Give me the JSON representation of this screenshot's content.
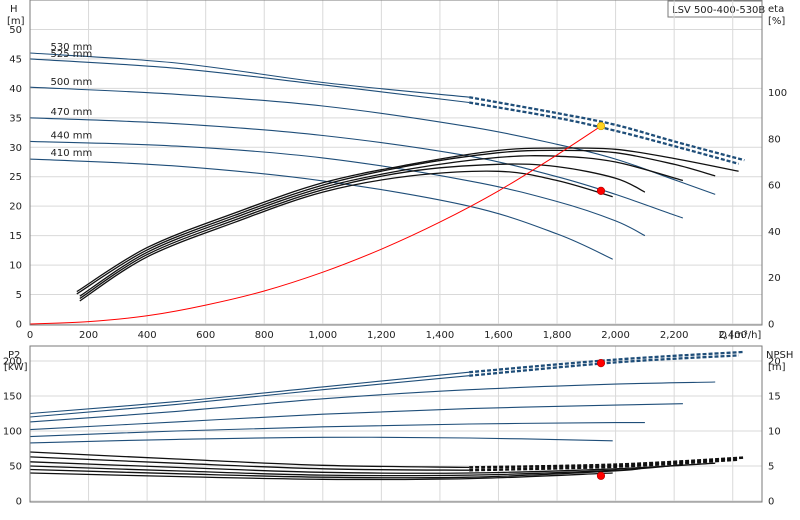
{
  "chart_data": [
    {
      "type": "line",
      "panel": "head",
      "title": "LSV 500-400-530B",
      "xlabel": "Q [m³/h]",
      "ylabel_left": {
        "name": "H",
        "unit": "[m]"
      },
      "ylabel_right": {
        "name": "eta",
        "unit": "[%]"
      },
      "xlim": [
        0,
        2500
      ],
      "ylim": [
        0,
        55
      ],
      "ylim_right": [
        0,
        140
      ],
      "x_ticks": [
        "0",
        "200",
        "400",
        "600",
        "800",
        "1,000",
        "1,200",
        "1,400",
        "1,600",
        "1,800",
        "2,000",
        "2,200",
        "2,400"
      ],
      "y_ticks": [
        "0",
        "5",
        "10",
        "15",
        "20",
        "25",
        "30",
        "35",
        "40",
        "45",
        "50"
      ],
      "y_right_ticks": [
        "0",
        "20",
        "40",
        "60",
        "80",
        "100"
      ],
      "grid": true,
      "colors": {
        "head": "#1f4e79",
        "efficiency": "#111111",
        "system": "#ff0000",
        "op_red": "#ff0000",
        "op_yellow": "#ffd21f"
      },
      "head_curves": [
        {
          "label": "530 mm",
          "x": [
            0,
            500,
            1000,
            1500,
            1800,
            2000,
            2200,
            2440
          ],
          "y": [
            46,
            44.3,
            41,
            38.5,
            35.8,
            33.8,
            31,
            27.8
          ],
          "dashed_from": 1500
        },
        {
          "label": "525 mm",
          "x": [
            0,
            500,
            1000,
            1500,
            1800,
            2000,
            2200,
            2420
          ],
          "y": [
            45,
            43.4,
            40.6,
            37.6,
            35,
            32.8,
            30.2,
            27.2
          ],
          "dashed_from": 1500
        },
        {
          "label": "500 mm",
          "x": [
            0,
            500,
            1000,
            1500,
            1800,
            2000,
            2200,
            2340
          ],
          "y": [
            40.2,
            39,
            37,
            33.5,
            30.5,
            28,
            24.5,
            22
          ]
        },
        {
          "label": "470 mm",
          "x": [
            0,
            500,
            1000,
            1500,
            1800,
            2000,
            2200,
            2230
          ],
          "y": [
            35,
            34,
            32,
            28.5,
            25,
            22,
            18.5,
            18
          ]
        },
        {
          "label": "440 mm",
          "x": [
            0,
            500,
            1000,
            1500,
            1800,
            2000,
            2100
          ],
          "y": [
            31,
            30.2,
            28.2,
            24.3,
            20.8,
            17.5,
            15
          ]
        },
        {
          "label": "410 mm",
          "x": [
            0,
            500,
            1000,
            1500,
            1800,
            1990
          ],
          "y": [
            28,
            26.8,
            24.3,
            20,
            15.3,
            11
          ]
        }
      ],
      "efficiency_curves": [
        {
          "x": [
            160,
            400,
            700,
            1000,
            1300,
            1600,
            1800,
            2000,
            2200,
            2420
          ],
          "y": [
            14,
            33,
            48,
            61,
            69,
            75,
            76,
            75.5,
            71.5,
            66
          ]
        },
        {
          "x": [
            160,
            400,
            700,
            1000,
            1300,
            1600,
            1800,
            2000,
            2200,
            2340
          ],
          "y": [
            13,
            32,
            47,
            60,
            68.5,
            74,
            75,
            74,
            69,
            64
          ]
        },
        {
          "x": [
            170,
            400,
            700,
            1000,
            1300,
            1600,
            1800,
            2000,
            2230
          ],
          "y": [
            12,
            31,
            46,
            59,
            67,
            72,
            72.5,
            70,
            62
          ]
        },
        {
          "x": [
            170,
            400,
            700,
            1000,
            1300,
            1600,
            1800,
            2000,
            2100
          ],
          "y": [
            11,
            30,
            45,
            58,
            66,
            69,
            68,
            63,
            57
          ]
        },
        {
          "x": [
            170,
            400,
            700,
            1000,
            1300,
            1600,
            1800,
            1990
          ],
          "y": [
            10,
            29,
            44,
            57,
            64,
            66,
            62,
            55
          ]
        }
      ],
      "system_curve": {
        "x": [
          0,
          200,
          400,
          600,
          800,
          1000,
          1200,
          1400,
          1600,
          1800,
          1950
        ],
        "y": [
          0,
          0.4,
          1.4,
          3.2,
          5.6,
          8.8,
          12.7,
          17.3,
          22.6,
          28.7,
          33.6
        ]
      },
      "operating_points": [
        {
          "x": 1950,
          "y": 33.6,
          "color": "yellow"
        },
        {
          "x": 1950,
          "y": 22.6,
          "color": "red"
        }
      ]
    },
    {
      "type": "line",
      "panel": "power_npsh",
      "ylabel_left": {
        "name": "P2",
        "unit": "[kW]"
      },
      "ylabel_right": {
        "name": "NPSH",
        "unit": "[m]"
      },
      "xlim": [
        0,
        2500
      ],
      "ylim": [
        0,
        220
      ],
      "ylim_right": [
        0,
        22
      ],
      "y_ticks": [
        "0",
        "50",
        "100",
        "150",
        "200"
      ],
      "y_right_ticks": [
        "0",
        "5",
        "10",
        "15",
        "20"
      ],
      "grid": true,
      "power_curves": [
        {
          "label": "530 mm",
          "x": [
            0,
            500,
            1000,
            1500,
            2000,
            2440
          ],
          "y": [
            125,
            142,
            163,
            184,
            202,
            213
          ],
          "dashed_from": 1500
        },
        {
          "label": "525 mm",
          "x": [
            0,
            500,
            1000,
            1500,
            2000,
            2420
          ],
          "y": [
            120,
            138,
            159,
            179,
            198,
            208
          ],
          "dashed_from": 1500
        },
        {
          "label": "500 mm",
          "x": [
            0,
            500,
            1000,
            1500,
            2000,
            2340
          ],
          "y": [
            113,
            128,
            146,
            159,
            167,
            170
          ]
        },
        {
          "label": "470 mm",
          "x": [
            0,
            500,
            1000,
            1500,
            2000,
            2230
          ],
          "y": [
            102,
            113,
            124,
            132,
            137,
            139
          ]
        },
        {
          "label": "440 mm",
          "x": [
            0,
            500,
            1000,
            1500,
            2000,
            2100
          ],
          "y": [
            92,
            100,
            106,
            110,
            112,
            112
          ]
        },
        {
          "label": "410 mm",
          "x": [
            0,
            500,
            1000,
            1500,
            1990
          ],
          "y": [
            83,
            88,
            91,
            90,
            86
          ]
        }
      ],
      "npsh_curves": [
        {
          "x": [
            0,
            500,
            1000,
            1500,
            2000,
            2440
          ],
          "y": [
            7,
            6,
            5.1,
            4.8,
            5.2,
            6.2
          ],
          "dashed_from": 1500
        },
        {
          "x": [
            0,
            500,
            1000,
            1500,
            2000,
            2420
          ],
          "y": [
            6.3,
            5.4,
            4.6,
            4.4,
            4.9,
            5.9
          ],
          "dashed_from": 1500
        },
        {
          "x": [
            0,
            500,
            1000,
            1500,
            2000,
            2340
          ],
          "y": [
            5.6,
            4.8,
            4.1,
            4,
            4.6,
            5.4
          ]
        },
        {
          "x": [
            0,
            500,
            1000,
            1500,
            2000,
            2230
          ],
          "y": [
            5,
            4.3,
            3.7,
            3.7,
            4.4,
            5.2
          ]
        },
        {
          "x": [
            0,
            500,
            1000,
            1500,
            2000,
            2100
          ],
          "y": [
            4.5,
            3.9,
            3.4,
            3.4,
            4.3,
            4.8
          ]
        },
        {
          "x": [
            0,
            500,
            1000,
            1500,
            1990
          ],
          "y": [
            4,
            3.5,
            3.1,
            3.2,
            4
          ]
        }
      ],
      "operating_points": [
        {
          "x": 1950,
          "y": 197,
          "color": "red"
        },
        {
          "x": 1950,
          "y_right": 3.6,
          "color": "red"
        }
      ]
    }
  ]
}
